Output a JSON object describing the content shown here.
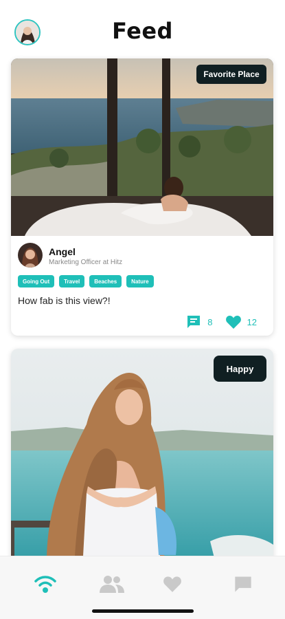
{
  "header": {
    "title": "Feed",
    "avatar_icon": "profile-avatar"
  },
  "colors": {
    "accent": "#1fbfb8",
    "badge_bg": "#101f22",
    "nav_inactive": "#c9c9c9"
  },
  "posts": [
    {
      "badge": "Favorite Place",
      "author": {
        "name": "Angel",
        "role": "Marketing Officer at Hitz"
      },
      "tags": [
        "Going Out",
        "Travel",
        "Beaches",
        "Nature"
      ],
      "caption": "How fab is this view?!",
      "comments": "8",
      "likes": "12"
    },
    {
      "badge": "Happy"
    }
  ],
  "nav": {
    "items": [
      {
        "icon": "feed-icon",
        "active": true
      },
      {
        "icon": "people-icon",
        "active": false
      },
      {
        "icon": "heart-icon",
        "active": false
      },
      {
        "icon": "chat-icon",
        "active": false
      }
    ]
  }
}
